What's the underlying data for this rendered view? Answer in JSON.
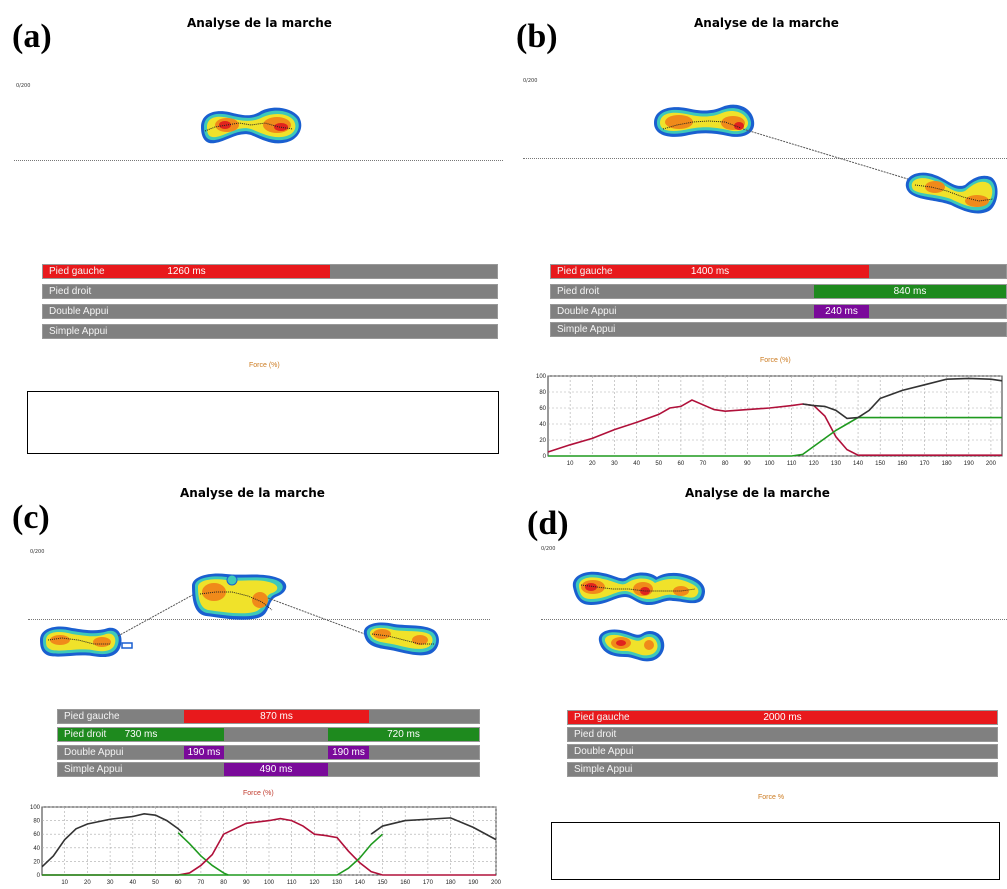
{
  "panels": {
    "a": {
      "letter": "(a)",
      "title": "Analyse de la marche",
      "scale": "0/200",
      "bars": [
        {
          "label": "Pied gauche",
          "seg_text": "1260 ms"
        },
        {
          "label": "Pied droit",
          "seg_text": ""
        },
        {
          "label": "Double Appui",
          "seg_text": ""
        },
        {
          "label": "Simple Appui",
          "seg_text": ""
        }
      ],
      "force_label": "Force (%)"
    },
    "b": {
      "letter": "(b)",
      "title": "Analyse de la marche",
      "scale": "0/200",
      "bars": [
        {
          "label": "Pied gauche",
          "seg_text": "1400 ms"
        },
        {
          "label": "Pied droit",
          "seg_text": "840 ms"
        },
        {
          "label": "Double Appui",
          "seg_text": "240 ms"
        },
        {
          "label": "Simple Appui",
          "seg_text": ""
        }
      ],
      "force_label": "Force (%)"
    },
    "c": {
      "letter": "(c)",
      "title": "Analyse de la marche",
      "scale": "0/200",
      "bars": [
        {
          "label": "Pied gauche",
          "seg_text": "870 ms"
        },
        {
          "label": "Pied droit",
          "seg_text": "730 ms",
          "seg2_text": "720 ms"
        },
        {
          "label": "Double Appui",
          "seg_text": "190 ms",
          "seg2_text": "190 ms"
        },
        {
          "label": "Simple Appui",
          "seg_text": "490 ms"
        }
      ],
      "force_label": "Force (%)"
    },
    "d": {
      "letter": "(d)",
      "title": "Analyse de la marche",
      "scale": "0/200",
      "bars": [
        {
          "label": "Pied gauche",
          "seg_text": "2000 ms"
        },
        {
          "label": "Pied droit",
          "seg_text": ""
        },
        {
          "label": "Double Appui",
          "seg_text": ""
        },
        {
          "label": "Simple Appui",
          "seg_text": ""
        }
      ],
      "force_label": "Force %"
    }
  },
  "colors": {
    "left_foot": "#e8191c",
    "right_foot": "#1e8a1e",
    "double_support": "#7a0a9a",
    "inactive_bar": "#808080",
    "left_force_curve": "#b0103a",
    "right_force_curve": "#1f9a1f",
    "total_force_curve": "#333333",
    "force_label": "#cc7a1f"
  },
  "chart_data": [
    {
      "panel": "b",
      "type": "line",
      "ylim": [
        0,
        100
      ],
      "xlim": [
        0,
        205
      ],
      "x_ticks": [
        10,
        20,
        30,
        40,
        50,
        60,
        70,
        80,
        90,
        100,
        110,
        120,
        130,
        140,
        150,
        160,
        170,
        180,
        190,
        200
      ],
      "y_ticks": [
        0,
        20,
        40,
        60,
        80,
        100
      ],
      "grid": true,
      "series": [
        {
          "key": "left",
          "color": "#b0103a",
          "x": [
            0,
            10,
            20,
            30,
            40,
            50,
            55,
            60,
            65,
            70,
            75,
            80,
            90,
            100,
            110,
            115,
            120,
            125,
            130,
            135,
            140,
            205
          ],
          "y": [
            5,
            14,
            22,
            33,
            42,
            52,
            60,
            62,
            70,
            64,
            58,
            56,
            58,
            60,
            63,
            65,
            63,
            50,
            24,
            8,
            1,
            1
          ]
        },
        {
          "key": "right",
          "color": "#1f9a1f",
          "x": [
            0,
            110,
            115,
            120,
            125,
            130,
            135,
            140,
            205
          ],
          "y": [
            0,
            0,
            2,
            12,
            22,
            32,
            40,
            48,
            48
          ]
        },
        {
          "key": "total",
          "color": "#333333",
          "x": [
            115,
            120,
            125,
            130,
            135,
            140,
            145,
            150,
            160,
            170,
            180,
            190,
            200,
            205
          ],
          "y": [
            65,
            63,
            62,
            57,
            47,
            48,
            57,
            72,
            82,
            89,
            96,
            97,
            96,
            94
          ]
        }
      ]
    },
    {
      "panel": "c",
      "type": "line",
      "ylim": [
        0,
        100
      ],
      "xlim": [
        0,
        200
      ],
      "x_ticks": [
        10,
        20,
        30,
        40,
        50,
        60,
        70,
        80,
        90,
        100,
        110,
        120,
        130,
        140,
        150,
        160,
        170,
        180,
        190,
        200
      ],
      "y_ticks": [
        0,
        20,
        40,
        60,
        80,
        100
      ],
      "grid": true,
      "series": [
        {
          "key": "total",
          "color": "#333333",
          "x": [
            0,
            5,
            10,
            15,
            20,
            30,
            40,
            45,
            50,
            55,
            60,
            62
          ],
          "y": [
            12,
            28,
            52,
            68,
            75,
            82,
            86,
            90,
            88,
            80,
            68,
            62
          ]
        },
        {
          "key": "right_1",
          "color": "#1f9a1f",
          "x": [
            60,
            65,
            70,
            75,
            80,
            82
          ],
          "y": [
            62,
            46,
            28,
            14,
            3,
            0
          ]
        },
        {
          "key": "left",
          "color": "#b0103a",
          "x": [
            0,
            60,
            65,
            70,
            75,
            80,
            90,
            100,
            105,
            110,
            115,
            120,
            125,
            130,
            135,
            140,
            145,
            150,
            200
          ],
          "y": [
            0,
            0,
            3,
            14,
            30,
            60,
            76,
            80,
            83,
            80,
            72,
            60,
            58,
            55,
            35,
            18,
            5,
            0,
            0
          ]
        },
        {
          "key": "right_2",
          "color": "#1f9a1f",
          "x": [
            0,
            60,
            80,
            130,
            135,
            140,
            145,
            150
          ],
          "y": [
            0,
            0,
            0,
            0,
            10,
            25,
            45,
            60
          ]
        },
        {
          "key": "total_2",
          "color": "#333333",
          "x": [
            145,
            150,
            155,
            160,
            170,
            180,
            190,
            200
          ],
          "y": [
            60,
            72,
            76,
            80,
            82,
            84,
            70,
            52
          ]
        }
      ]
    }
  ]
}
